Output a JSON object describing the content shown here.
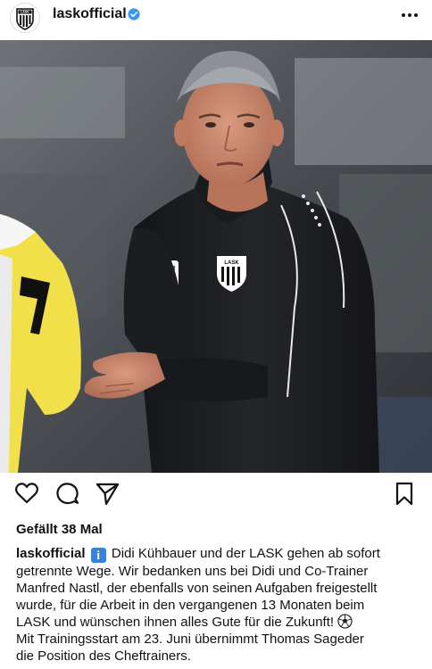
{
  "post": {
    "username": "laskofficial",
    "avatar_label": "LASK",
    "jacket_logo": "LASK",
    "likes_text": "Gefällt 38 Mal",
    "caption_lines": [
      {
        "text_before": "",
        "username": "laskofficial",
        "has_info_emoji": true,
        "text": " Didi Kühbauer und der LASK gehen ab sofort"
      },
      {
        "text": "getrennte Wege.  Wir bedanken uns bei Didi und Co-Trainer"
      },
      {
        "text": "Manfred Nastl, der ebenfalls von seinen Aufgaben freigestellt"
      },
      {
        "text": "wurde, für die Arbeit in den vergangenen 13 Monaten beim"
      },
      {
        "text": "LASK und wünschen ihnen alles Gute für die Zukunft! "
      },
      {
        "text": "Mit Trainingsstart am 23. Juni übernimmt Thomas Sageder"
      },
      {
        "text": "die Position des Cheftrainers."
      }
    ]
  },
  "icons": {
    "verified": "verified-badge-icon",
    "more": "more-options-icon",
    "like": "heart-icon",
    "comment": "comment-icon",
    "share": "send-icon",
    "save": "bookmark-icon",
    "info_emoji": "information-emoji",
    "ball_emoji": "soccer-ball-emoji"
  },
  "colors": {
    "verified_blue": "#3897f0",
    "text": "#111111",
    "jacket": "#1b1c1f"
  }
}
